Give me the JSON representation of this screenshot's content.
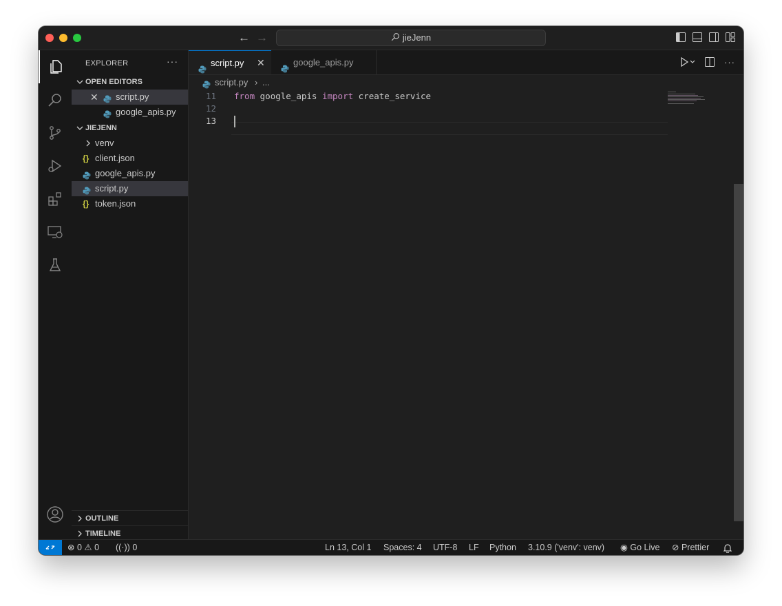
{
  "titlebar": {
    "search_text": "jieJenn"
  },
  "sidebar": {
    "title": "EXPLORER",
    "more": "···",
    "open_editors_label": "OPEN EDITORS",
    "open_editors": [
      {
        "label": "script.py"
      },
      {
        "label": "google_apis.py"
      }
    ],
    "folder_label": "JIEJENN",
    "files": [
      {
        "label": "venv",
        "icon": "chevron-right-icon"
      },
      {
        "label": "client.json",
        "icon": "json-icon"
      },
      {
        "label": "google_apis.py",
        "icon": "python-icon"
      },
      {
        "label": "script.py",
        "icon": "python-icon"
      },
      {
        "label": "token.json",
        "icon": "json-icon"
      }
    ],
    "outline_label": "OUTLINE",
    "timeline_label": "TIMELINE"
  },
  "tabs": [
    {
      "label": "script.py"
    },
    {
      "label": "google_apis.py"
    }
  ],
  "breadcrumb": {
    "file": "script.py",
    "rest": "..."
  },
  "editor": {
    "lines": [
      {
        "num": "11",
        "tokens": [
          "from",
          "google_apis",
          "import",
          "create_service"
        ]
      },
      {
        "num": "12"
      },
      {
        "num": "13"
      }
    ]
  },
  "statusbar": {
    "errors": "0",
    "warnings": "0",
    "ports": "0",
    "position": "Ln 13, Col 1",
    "spaces": "Spaces: 4",
    "encoding": "UTF-8",
    "eol": "LF",
    "language": "Python",
    "interpreter": "3.10.9 ('venv': venv)",
    "golive": "Go Live",
    "prettier": "Prettier"
  },
  "colors": {
    "accent": "#0078d4",
    "keyword": "#c586c0",
    "json": "#cbcb41",
    "python": "#519aba"
  }
}
